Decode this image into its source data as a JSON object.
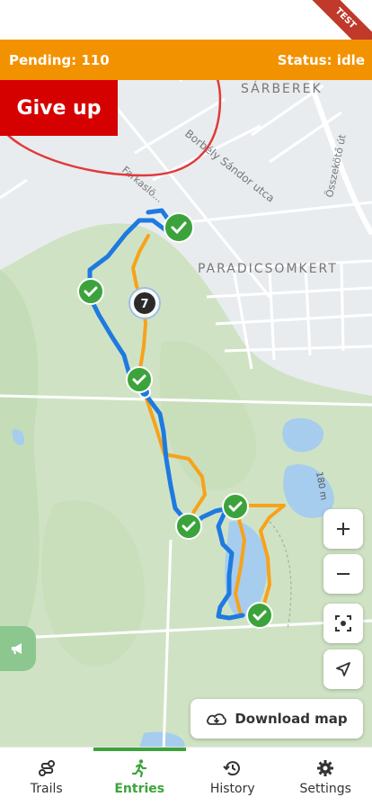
{
  "header": {
    "pending_label": "Pending: 110",
    "status_label": "Status: idle",
    "test_badge": "TEST",
    "accent": "#f39200"
  },
  "give_up_label": "Give up",
  "map": {
    "labels": {
      "sarberek": "SÁRBEREK",
      "borbely": "Borbély Sándor utca",
      "farkaslo": "Farkaslö...",
      "osszekoto": "Összekötő út",
      "paradicsom": "PARADICSOMKERT",
      "distance": "180 m"
    },
    "cluster_count": "7"
  },
  "map_controls": {
    "zoom_in_icon": "plus-icon",
    "zoom_out_icon": "minus-icon",
    "center_icon": "target-icon",
    "locate_icon": "navigate-arrow-icon"
  },
  "download_map_label": "Download map",
  "nav": {
    "items": [
      {
        "label": "Trails"
      },
      {
        "label": "Entries"
      },
      {
        "label": "History"
      },
      {
        "label": "Settings"
      }
    ],
    "active_color": "#3ca33c"
  }
}
